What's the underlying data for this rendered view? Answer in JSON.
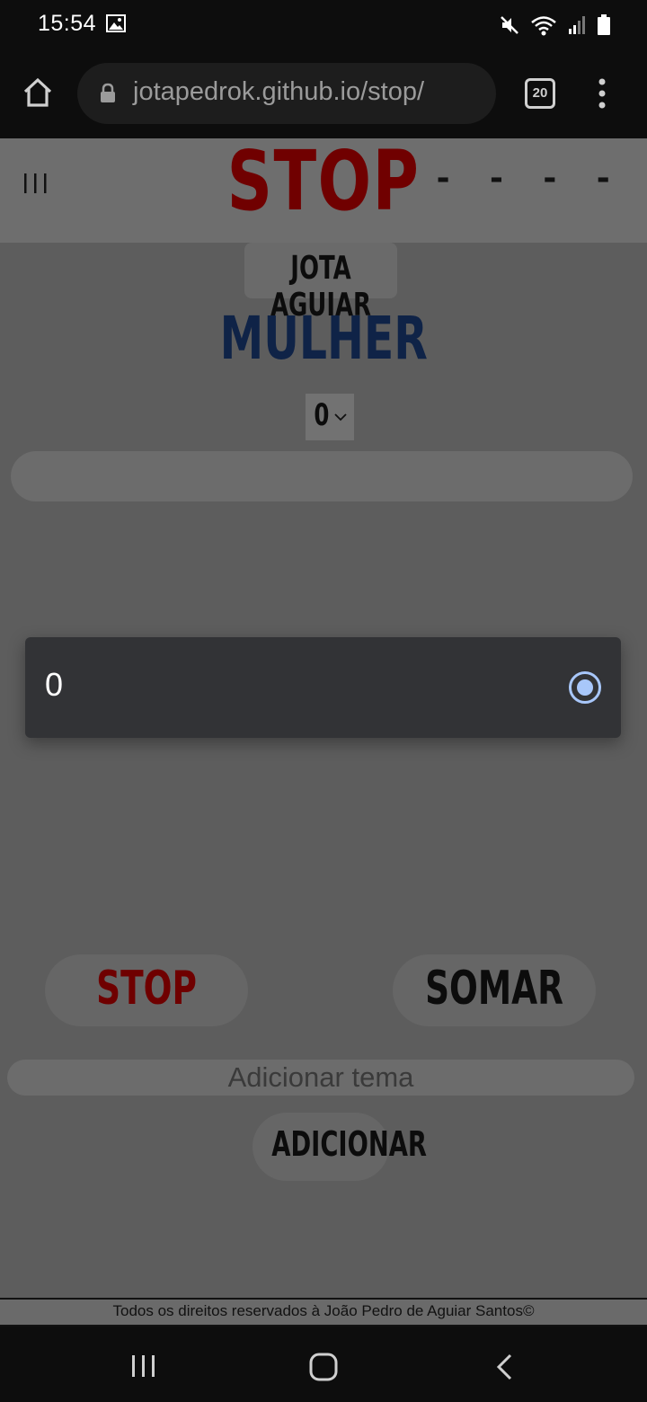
{
  "status_bar": {
    "time": "15:54",
    "icons": [
      "image-notification-icon",
      "mute-icon",
      "wifi-icon",
      "signal-icon",
      "battery-icon"
    ]
  },
  "browser": {
    "url": "jotapedrok.github.io/stop/",
    "tab_count": "20",
    "icons": [
      "home-icon",
      "lock-icon",
      "tabs-icon",
      "more-vert-icon"
    ]
  },
  "header": {
    "title": "STOP",
    "timer": "- - - -",
    "menu_icon": "menu-icon"
  },
  "game": {
    "player": "JOTA AGUIAR",
    "category": "MULHER",
    "round_value": "0",
    "answer_value": ""
  },
  "dropdown": {
    "option": "0",
    "selected": true
  },
  "actions": {
    "stop_label": "STOP",
    "sum_label": "SOMAR",
    "theme_placeholder": "Adicionar tema",
    "add_label": "ADICIONAR"
  },
  "footer": {
    "text": "Todos os direitos reservados à João Pedro de Aguiar Santos©"
  },
  "colors": {
    "brand_red": "#700000",
    "category_blue": "#0f2347",
    "radio_accent": "#a8c7fa"
  }
}
